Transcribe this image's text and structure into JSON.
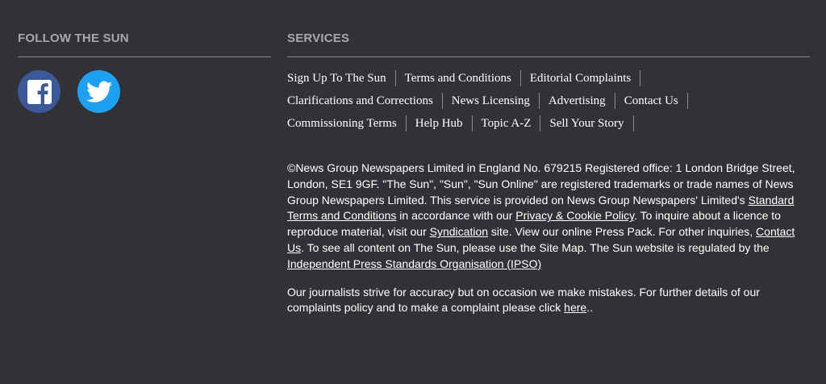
{
  "follow": {
    "heading": "FOLLOW THE SUN",
    "icons": [
      "facebook-icon",
      "twitter-icon"
    ],
    "colors": {
      "facebook": "#3b5998",
      "twitter": "#1da1f2"
    }
  },
  "services": {
    "heading": "SERVICES",
    "rows": [
      [
        "Sign Up To The Sun",
        "Terms and Conditions",
        "Editorial Complaints"
      ],
      [
        "Clarifications and Corrections",
        "News Licensing",
        "Advertising",
        "Contact Us"
      ],
      [
        "Commissioning Terms",
        "Help Hub",
        "Topic A-Z",
        "Sell Your Story"
      ]
    ]
  },
  "legal": {
    "p1_a": "©News Group Newspapers Limited in England No. 679215 Registered office: 1 London Bridge Street, London, SE1 9GF. \"The Sun\", \"Sun\", \"Sun Online\" are registered trademarks or trade names of News Group Newspapers Limited. This service is provided on News Group Newspapers' Limited's ",
    "link_standard_terms": "Standard Terms and Conditions",
    "p1_b": " in accordance with our ",
    "link_privacy": "Privacy & Cookie Policy",
    "p1_c": ". To inquire about a licence to reproduce material, visit our ",
    "link_syndication": "Syndication",
    "p1_d": " site. View our online Press Pack. For other inquiries, ",
    "link_contact": "Contact Us",
    "p1_e": ". To see all content on The Sun, please use the Site Map. The Sun website is regulated by the ",
    "link_ipso": "Independent Press Standards Organisation (IPSO)",
    "p2_a": "Our journalists strive for accuracy but on occasion we make mistakes. For further details of our complaints policy and to make a complaint please click ",
    "link_here": "here",
    "p2_b": ".."
  }
}
